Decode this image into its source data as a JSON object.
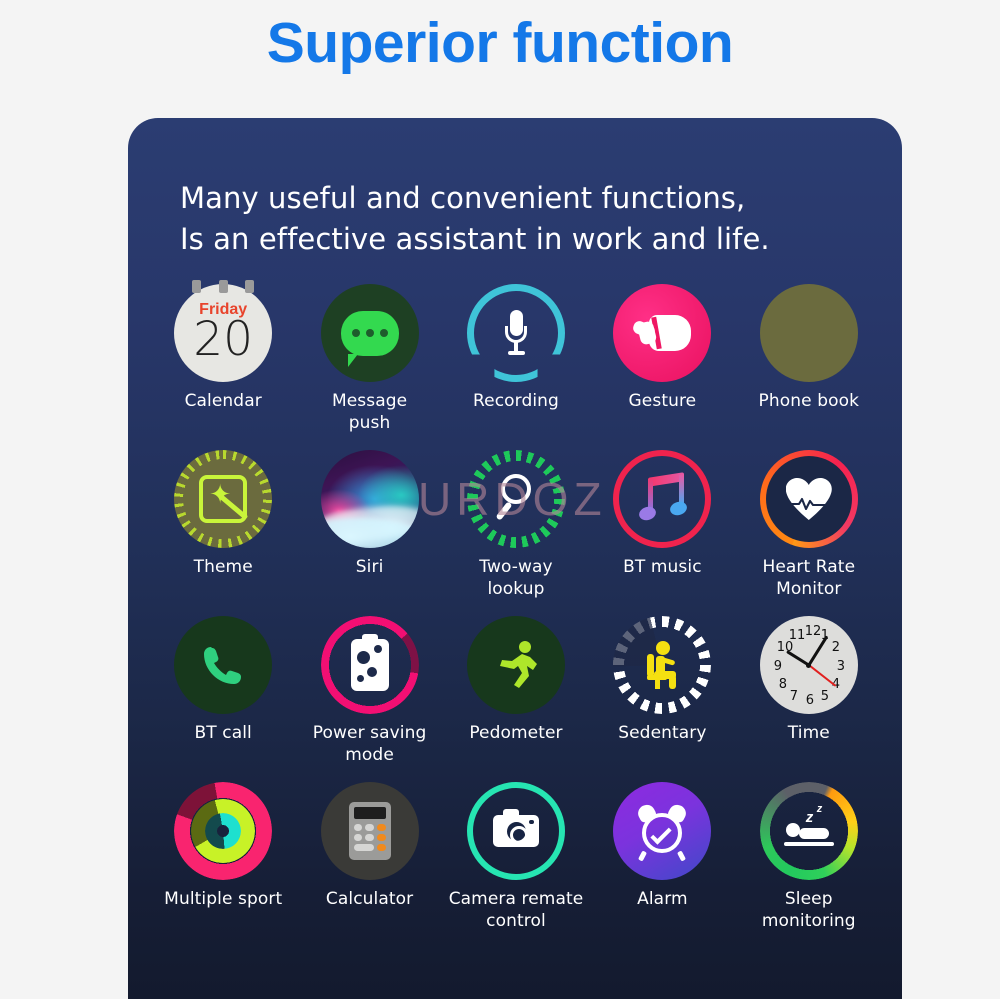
{
  "page": {
    "title": "Superior function",
    "title_color": "#1478e8",
    "background_color": "#f4f4f4"
  },
  "card": {
    "subtitle_line1": "Many useful and convenient functions,",
    "subtitle_line2": "Is an effective assistant in work and life.",
    "background_top": "#2b3d72",
    "background_bottom": "#131a2e"
  },
  "watermark": {
    "text": "URDOZ",
    "color": "#b08496"
  },
  "calendar": {
    "weekday": "Friday",
    "date": "20",
    "weekday_color": "#e8442c"
  },
  "features": [
    {
      "label": "Calendar",
      "icon": "calendar-icon"
    },
    {
      "label": "Message\npush",
      "icon": "message-bubble-icon"
    },
    {
      "label": "Recording",
      "icon": "microphone-icon"
    },
    {
      "label": "Gesture",
      "icon": "fist-hand-icon"
    },
    {
      "label": "Phone book",
      "icon": "contacts-people-icon"
    },
    {
      "label": "Theme",
      "icon": "magic-wand-icon"
    },
    {
      "label": "Siri",
      "icon": "siri-orb-icon"
    },
    {
      "label": "Two-way\nlookup",
      "icon": "magnifier-icon"
    },
    {
      "label": "BT music",
      "icon": "music-note-icon"
    },
    {
      "label": "Heart Rate\nMonitor",
      "icon": "heart-pulse-icon"
    },
    {
      "label": "BT call",
      "icon": "phone-handset-icon"
    },
    {
      "label": "Power saving\nmode",
      "icon": "battery-icon"
    },
    {
      "label": "Pedometer",
      "icon": "runner-icon"
    },
    {
      "label": "Sedentary",
      "icon": "seated-person-icon"
    },
    {
      "label": "Time",
      "icon": "analog-clock-icon"
    },
    {
      "label": "Multiple sport",
      "icon": "activity-rings-icon"
    },
    {
      "label": "Calculator",
      "icon": "calculator-icon"
    },
    {
      "label": "Camera remate\ncontrol",
      "icon": "camera-icon"
    },
    {
      "label": "Alarm",
      "icon": "alarm-clock-icon"
    },
    {
      "label": "Sleep\nmonitoring",
      "icon": "sleep-bed-icon"
    }
  ],
  "clock": {
    "numbers": [
      "1",
      "2",
      "3",
      "4",
      "5",
      "6",
      "7",
      "8",
      "9",
      "10",
      "11",
      "12"
    ]
  }
}
